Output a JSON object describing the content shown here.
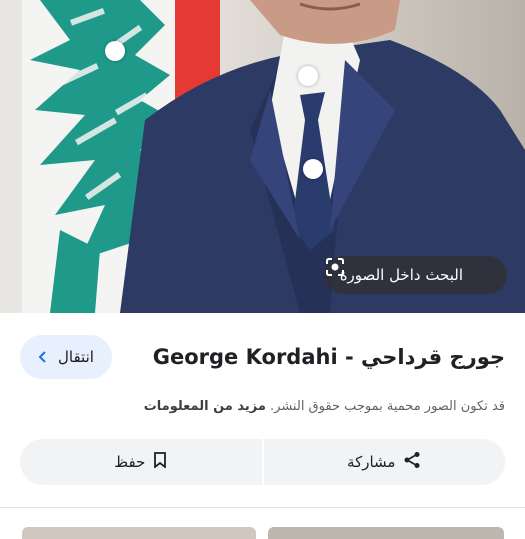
{
  "image": {
    "lens_button_label": "البحث داخل الصورة",
    "lens_icon": "lens-camera-icon"
  },
  "result": {
    "title": "جورج قرداحي - George Kordahi",
    "visit_label": "انتقال",
    "visit_icon": "chevron-right-icon",
    "copyright_notice": "قد تكون الصور محمية بموجب حقوق النشر.",
    "more_info_label": "مزيد من المعلومات"
  },
  "actions": {
    "share_label": "مشاركة",
    "share_icon": "share-icon",
    "save_label": "حفظ",
    "save_icon": "bookmark-icon"
  },
  "colors": {
    "accent": "#1a73e8",
    "visit_bg": "#e8f0fe",
    "action_bg": "#f1f3f4",
    "flag_green": "#1f9a8a",
    "flag_red": "#e53935",
    "suit_navy": "#2d3a64"
  }
}
